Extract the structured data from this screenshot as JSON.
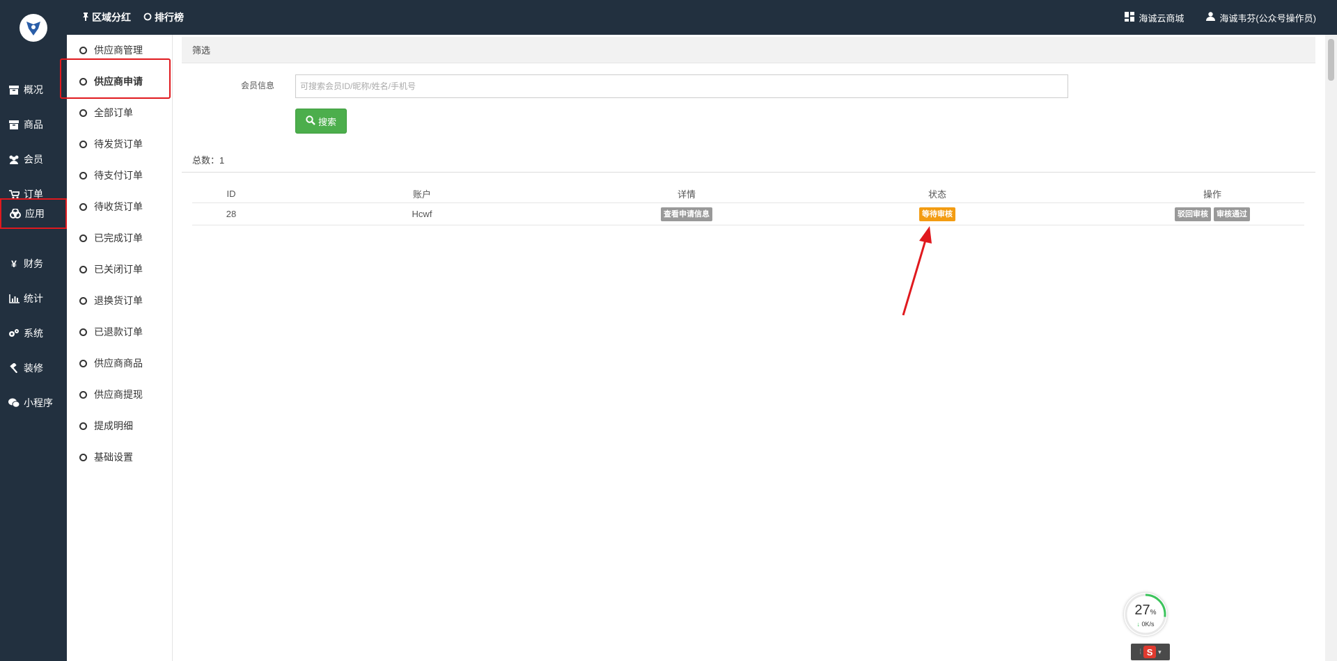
{
  "header": {
    "nav": [
      {
        "icon": "pin-icon",
        "label": "区域分红"
      },
      {
        "icon": "circle-icon",
        "label": "排行榜"
      }
    ],
    "right": {
      "store_label": "海诚云商城",
      "user_label": "海诚韦芬(公众号操作员)"
    }
  },
  "sidebar": {
    "items": [
      {
        "label": "概况",
        "icon": "box-icon"
      },
      {
        "label": "商品",
        "icon": "box-icon"
      },
      {
        "label": "会员",
        "icon": "users-icon"
      },
      {
        "label": "订单",
        "icon": "cart-icon"
      },
      {
        "label": "应用",
        "icon": "apps-icon",
        "active": true
      },
      {
        "label": "财务",
        "icon": "yen-icon"
      },
      {
        "label": "统计",
        "icon": "bar-chart-icon"
      },
      {
        "label": "系统",
        "icon": "gears-icon"
      },
      {
        "label": "装修",
        "icon": "hammer-icon"
      },
      {
        "label": "小程序",
        "icon": "wechat-icon"
      }
    ]
  },
  "subnav": {
    "items": [
      {
        "label": "供应商管理"
      },
      {
        "label": "供应商申请",
        "active": true
      },
      {
        "label": "全部订单"
      },
      {
        "label": "待发货订单"
      },
      {
        "label": "待支付订单"
      },
      {
        "label": "待收货订单"
      },
      {
        "label": "已完成订单"
      },
      {
        "label": "已关闭订单"
      },
      {
        "label": "退换货订单"
      },
      {
        "label": "已退款订单"
      },
      {
        "label": "供应商商品"
      },
      {
        "label": "供应商提现"
      },
      {
        "label": "提成明细"
      },
      {
        "label": "基础设置"
      }
    ]
  },
  "filter": {
    "title": "筛选",
    "member_label": "会员信息",
    "search_placeholder": "可搜索会员ID/昵称/姓名/手机号",
    "search_button": "搜索"
  },
  "summary": {
    "total_text": "总数：1"
  },
  "table": {
    "headers": [
      "ID",
      "账户",
      "详情",
      "状态",
      "操作"
    ],
    "rows": [
      {
        "id": "28",
        "account": "Hcwf",
        "detail_button": "查看申请信息",
        "status": "等待审核",
        "actions": [
          "驳回审核",
          "审核通过"
        ]
      }
    ]
  },
  "widget": {
    "percent": "27",
    "percent_unit": "%",
    "speed": "0K/s"
  },
  "colors": {
    "sidebar_bg": "#22303f",
    "highlight_border": "#e0191e",
    "search_button": "#4cae4c",
    "status_pending": "#f39c12",
    "action_tag": "#999999"
  }
}
